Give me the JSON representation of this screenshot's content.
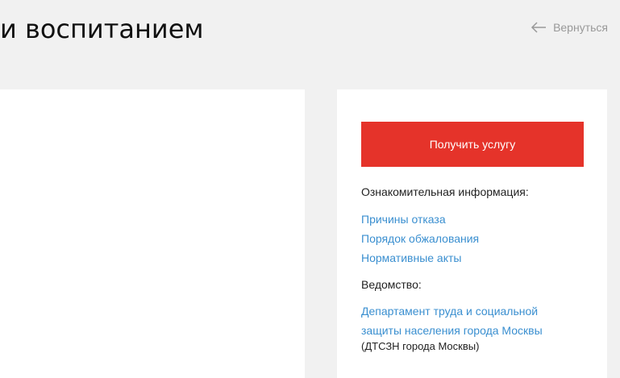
{
  "header": {
    "title": "и воспитанием",
    "back_label": "Вернуться"
  },
  "sidebar": {
    "get_service_label": "Получить услугу",
    "info_heading": "Ознакомительная информация:",
    "info_links": [
      {
        "label": "Причины отказа"
      },
      {
        "label": "Порядок обжалования"
      },
      {
        "label": "Нормативные акты"
      }
    ],
    "department_heading": "Ведомство:",
    "department_line1": "Департамент труда и социальной",
    "department_line2": "защиты населения города Москвы",
    "department_abbr": "(ДТСЗН города Москвы)"
  },
  "colors": {
    "accent_red": "#e5332a",
    "link_blue": "#3a8fd0",
    "background": "#f1f1f1"
  },
  "icons": {
    "back": "arrow-left-icon"
  }
}
